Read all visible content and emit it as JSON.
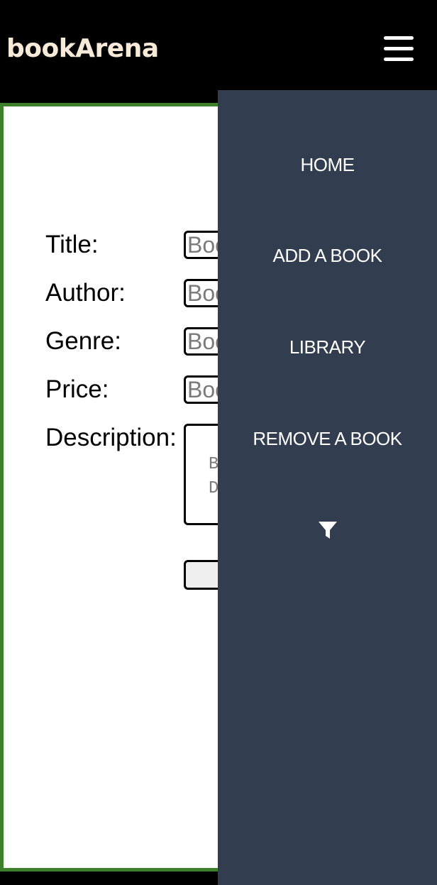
{
  "header": {
    "brand": "bookArena",
    "menu_icon": "hamburger-menu-icon"
  },
  "form": {
    "title_label": "Title:",
    "author_label": "Author:",
    "genre_label": "Genre:",
    "price_label": "Price:",
    "description_label": "Description:",
    "title_placeholder": "Book Title",
    "author_placeholder": "Book Author",
    "genre_placeholder": "Book Genre",
    "price_placeholder": "Book Price",
    "description_placeholder": "Book\nDescription",
    "submit_label": ""
  },
  "drawer": {
    "items": [
      {
        "label": "HOME"
      },
      {
        "label": "ADD A BOOK"
      },
      {
        "label": "LIBRARY"
      },
      {
        "label": "REMOVE A BOOK"
      }
    ],
    "filter_icon": "filter-funnel-icon"
  },
  "colors": {
    "header_bg": "#000000",
    "brand": "#f7ead8",
    "content_border": "#3e7f2b",
    "drawer_bg": "#323e4f",
    "drawer_text": "#ffffff"
  }
}
